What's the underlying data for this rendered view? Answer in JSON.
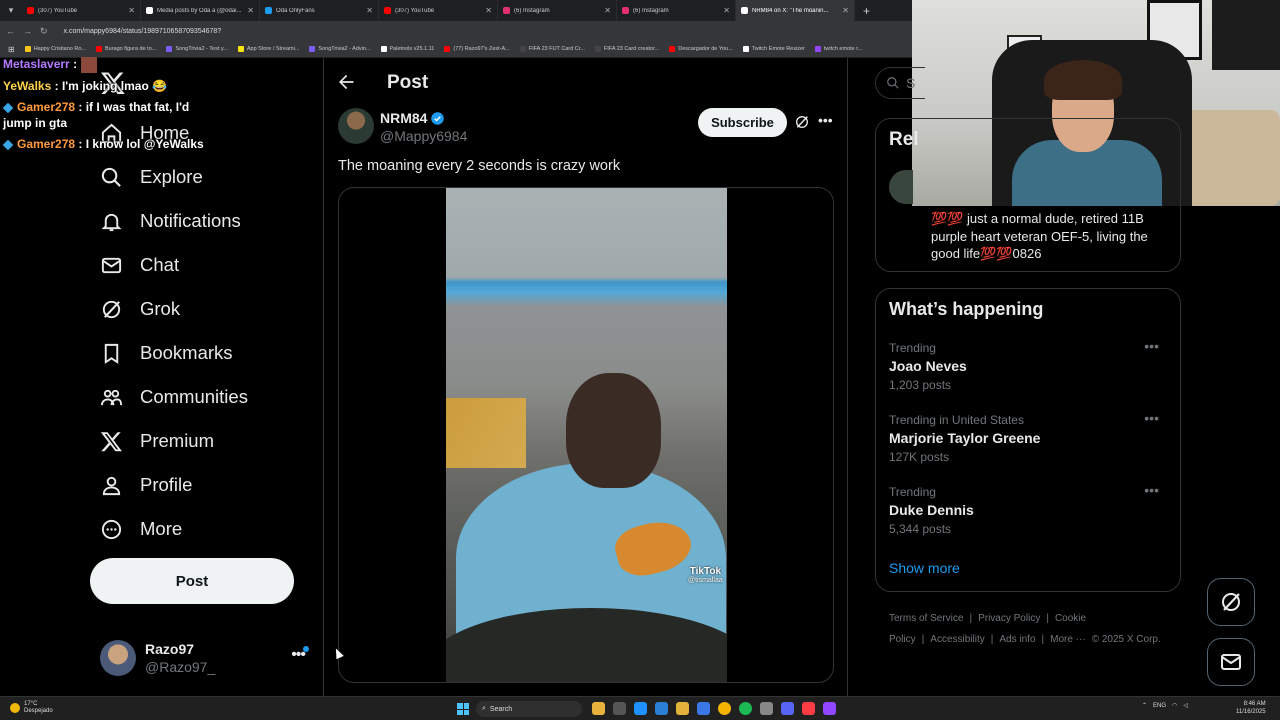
{
  "browser": {
    "tabs": [
      {
        "label": "(307) YouTube",
        "color": "#ff0000"
      },
      {
        "label": "Media posts by Oda a (@odai...",
        "color": "#ffffff"
      },
      {
        "label": "Oda OnlyFans",
        "color": "#1d9bf0"
      },
      {
        "label": "(307) YouTube",
        "color": "#ff0000"
      },
      {
        "label": "(6) Instagram",
        "color": "#e1306c"
      },
      {
        "label": "(6) Instagram",
        "color": "#e1306c"
      },
      {
        "label": "NRM84 on X: \"The moanin...",
        "color": "#ffffff",
        "active": true
      }
    ],
    "url": "x.com/mappy6984/status/1989710658709354678?",
    "bookmarks": [
      {
        "label": "Happy Cristiano Ro...",
        "color": "#f5c518"
      },
      {
        "label": "Burago figura de to...",
        "color": "#ff0000"
      },
      {
        "label": "SongTrivia2 - Test y...",
        "color": "#7c5cff"
      },
      {
        "label": "App Store / Streami...",
        "color": "#f5e50a"
      },
      {
        "label": "SongTrivia2 - Advin...",
        "color": "#7c5cff"
      },
      {
        "label": "Paletools v25.1.11",
        "color": "#ffffff"
      },
      {
        "label": "(77) Razo97's Zest-A...",
        "color": "#ff0000"
      },
      {
        "label": "FIFA 23 FUT Card Cr...",
        "color": "#444444"
      },
      {
        "label": "FIFA 23 Card creator...",
        "color": "#444444"
      },
      {
        "label": "Descargador de You...",
        "color": "#ff0000"
      },
      {
        "label": "Twitch Emote Resizer",
        "color": "#ffffff"
      },
      {
        "label": "twitch emote r...",
        "color": "#9146ff"
      }
    ]
  },
  "chat": [
    {
      "user": "Metaslaverr",
      "color": "#b57bff",
      "text": ":",
      "badge": false,
      "emote": true
    },
    {
      "user": "YeWalks",
      "color": "#ffd24a",
      "text": ": I'm joking lmao 😂",
      "badge": false,
      "emote": false
    },
    {
      "user": "Gamer278",
      "color": "#ff9a3c",
      "text": ": if I was that fat, I'd jump in gta",
      "badge": true,
      "emote": false
    },
    {
      "user": "Gamer278",
      "color": "#ff9a3c",
      "text": ": I know lol @YeWalks",
      "badge": true,
      "emote": false
    }
  ],
  "nav": {
    "items": [
      {
        "label": "Home",
        "icon": "home-icon"
      },
      {
        "label": "Explore",
        "icon": "search-icon"
      },
      {
        "label": "Notifications",
        "icon": "bell-icon"
      },
      {
        "label": "Chat",
        "icon": "mail-icon"
      },
      {
        "label": "Grok",
        "icon": "grok-icon"
      },
      {
        "label": "Bookmarks",
        "icon": "bookmark-icon"
      },
      {
        "label": "Communities",
        "icon": "people-icon"
      },
      {
        "label": "Premium",
        "icon": "x-icon"
      },
      {
        "label": "Profile",
        "icon": "person-icon"
      },
      {
        "label": "More",
        "icon": "more-circle-icon"
      }
    ],
    "post_label": "Post",
    "account": {
      "name": "Razo97",
      "handle": "@Razo97_"
    }
  },
  "post": {
    "header_title": "Post",
    "author_name": "NRM84",
    "author_handle": "@Mappy6984",
    "subscribe_label": "Subscribe",
    "text": "The moaning every 2 seconds is crazy work",
    "video_watermark": "TikTok",
    "video_watermark_user": "@tismallaa"
  },
  "right": {
    "search_placeholder": "S",
    "relevant_title": "Rel",
    "relevant_bio": "💯💯 just a normal dude, retired 11B purple heart veteran OEF-5, living the good life💯💯0826",
    "happening_title": "What’s happening",
    "trends": [
      {
        "context": "Trending",
        "name": "Joao Neves",
        "count": "1,203 posts"
      },
      {
        "context": "Trending in United States",
        "name": "Marjorie Taylor Greene",
        "count": "127K posts"
      },
      {
        "context": "Trending",
        "name": "Duke Dennis",
        "count": "5,344 posts"
      }
    ],
    "show_more": "Show more",
    "footer": [
      "Terms of Service",
      "|",
      "Privacy Policy",
      "|",
      "Cookie Policy",
      "|",
      "Accessibility",
      "|",
      "Ads info",
      "|",
      "More ···",
      "© 2025 X Corp."
    ]
  },
  "taskbar": {
    "temp": "17°C",
    "weather": "Despejado",
    "search_label": "Search",
    "lang": "ENG",
    "time": "8:46 AM",
    "date": "11/16/2025"
  }
}
